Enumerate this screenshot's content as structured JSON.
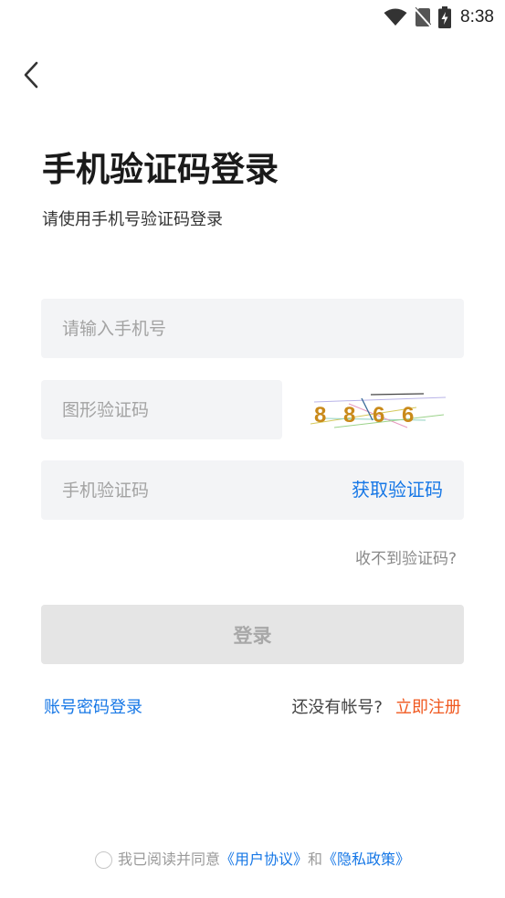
{
  "status_bar": {
    "time": "8:38",
    "icons": [
      "wifi-icon",
      "no-sim-icon",
      "battery-charging-icon"
    ]
  },
  "header": {
    "back_icon": "chevron-left-icon"
  },
  "title": "手机验证码登录",
  "subtitle": "请使用手机号验证码登录",
  "form": {
    "phone_placeholder": "请输入手机号",
    "captcha_placeholder": "图形验证码",
    "captcha_text": "8 8 6 6",
    "sms_placeholder": "手机验证码",
    "get_code_label": "获取验证码",
    "no_code_label": "收不到验证码?",
    "login_label": "登录"
  },
  "footer_links": {
    "password_login": "账号密码登录",
    "no_account": "还没有帐号?",
    "register": "立即注册"
  },
  "agreement": {
    "prefix": "我已阅读并同意",
    "user_agreement": "《用户协议》",
    "and": "和",
    "privacy_policy": "《隐私政策》"
  },
  "colors": {
    "link_blue": "#1677e6",
    "register_orange": "#f0581f",
    "field_bg": "#f3f4f6",
    "button_disabled_bg": "#e5e5e5"
  }
}
